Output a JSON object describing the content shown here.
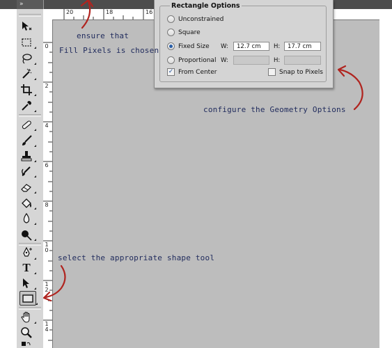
{
  "tool_panel": {
    "header_glyph": "»",
    "tools": [
      {
        "id": "move",
        "icon": "move-tool-icon"
      },
      {
        "id": "marquee",
        "icon": "marquee-tool-icon"
      },
      {
        "id": "lasso",
        "icon": "lasso-tool-icon"
      },
      {
        "id": "magic-wand",
        "icon": "magic-wand-tool-icon"
      },
      {
        "id": "crop",
        "icon": "crop-tool-icon"
      },
      {
        "id": "eyedropper",
        "icon": "eyedropper-tool-icon"
      },
      {
        "id": "healing",
        "icon": "healing-brush-icon"
      },
      {
        "id": "brush",
        "icon": "brush-tool-icon"
      },
      {
        "id": "clone-stamp",
        "icon": "clone-stamp-icon"
      },
      {
        "id": "history-brush",
        "icon": "history-brush-icon"
      },
      {
        "id": "eraser",
        "icon": "eraser-tool-icon"
      },
      {
        "id": "paint-bucket",
        "icon": "paint-bucket-icon"
      },
      {
        "id": "blur",
        "icon": "blur-tool-icon"
      },
      {
        "id": "dodge",
        "icon": "dodge-tool-icon"
      },
      {
        "id": "pen",
        "icon": "pen-tool-icon"
      },
      {
        "id": "type",
        "icon": "type-tool-icon",
        "glyph": "T"
      },
      {
        "id": "path-selection",
        "icon": "path-selection-icon"
      },
      {
        "id": "shape",
        "icon": "rectangle-shape-icon",
        "selected": true
      },
      {
        "id": "hand",
        "icon": "hand-tool-icon"
      },
      {
        "id": "zoom",
        "icon": "zoom-tool-icon"
      }
    ]
  },
  "rulers": {
    "horizontal": [
      "20",
      "18",
      "16"
    ],
    "vertical": [
      "0",
      "2",
      "4",
      "6",
      "8",
      "1\n0",
      "1\n2",
      "1\n4"
    ]
  },
  "rectangle_options": {
    "title": "Rectangle Options",
    "unconstrained": "Unconstrained",
    "square": "Square",
    "fixed_size": "Fixed Size",
    "proportional": "Proportional",
    "from_center": "From Center",
    "snap_to_pixels": "Snap to Pixels",
    "w_label": "W:",
    "h_label": "H:",
    "fixed_w": "12.7 cm",
    "fixed_h": "17.7 cm",
    "selected": "fixed_size",
    "from_center_checked": true,
    "snap_to_pixels_checked": false,
    "check_glyph": "✓"
  },
  "annotations": {
    "fill_pixels_1": "ensure that",
    "fill_pixels_2": "Fill Pixels is chosen",
    "geometry": "configure the Geometry Options",
    "shape_tool": "select the appropriate shape tool"
  },
  "colors": {
    "annotation_text": "#1f2a5c",
    "arrow_red": "#b0241f",
    "canvas": "#bdbdbd"
  }
}
